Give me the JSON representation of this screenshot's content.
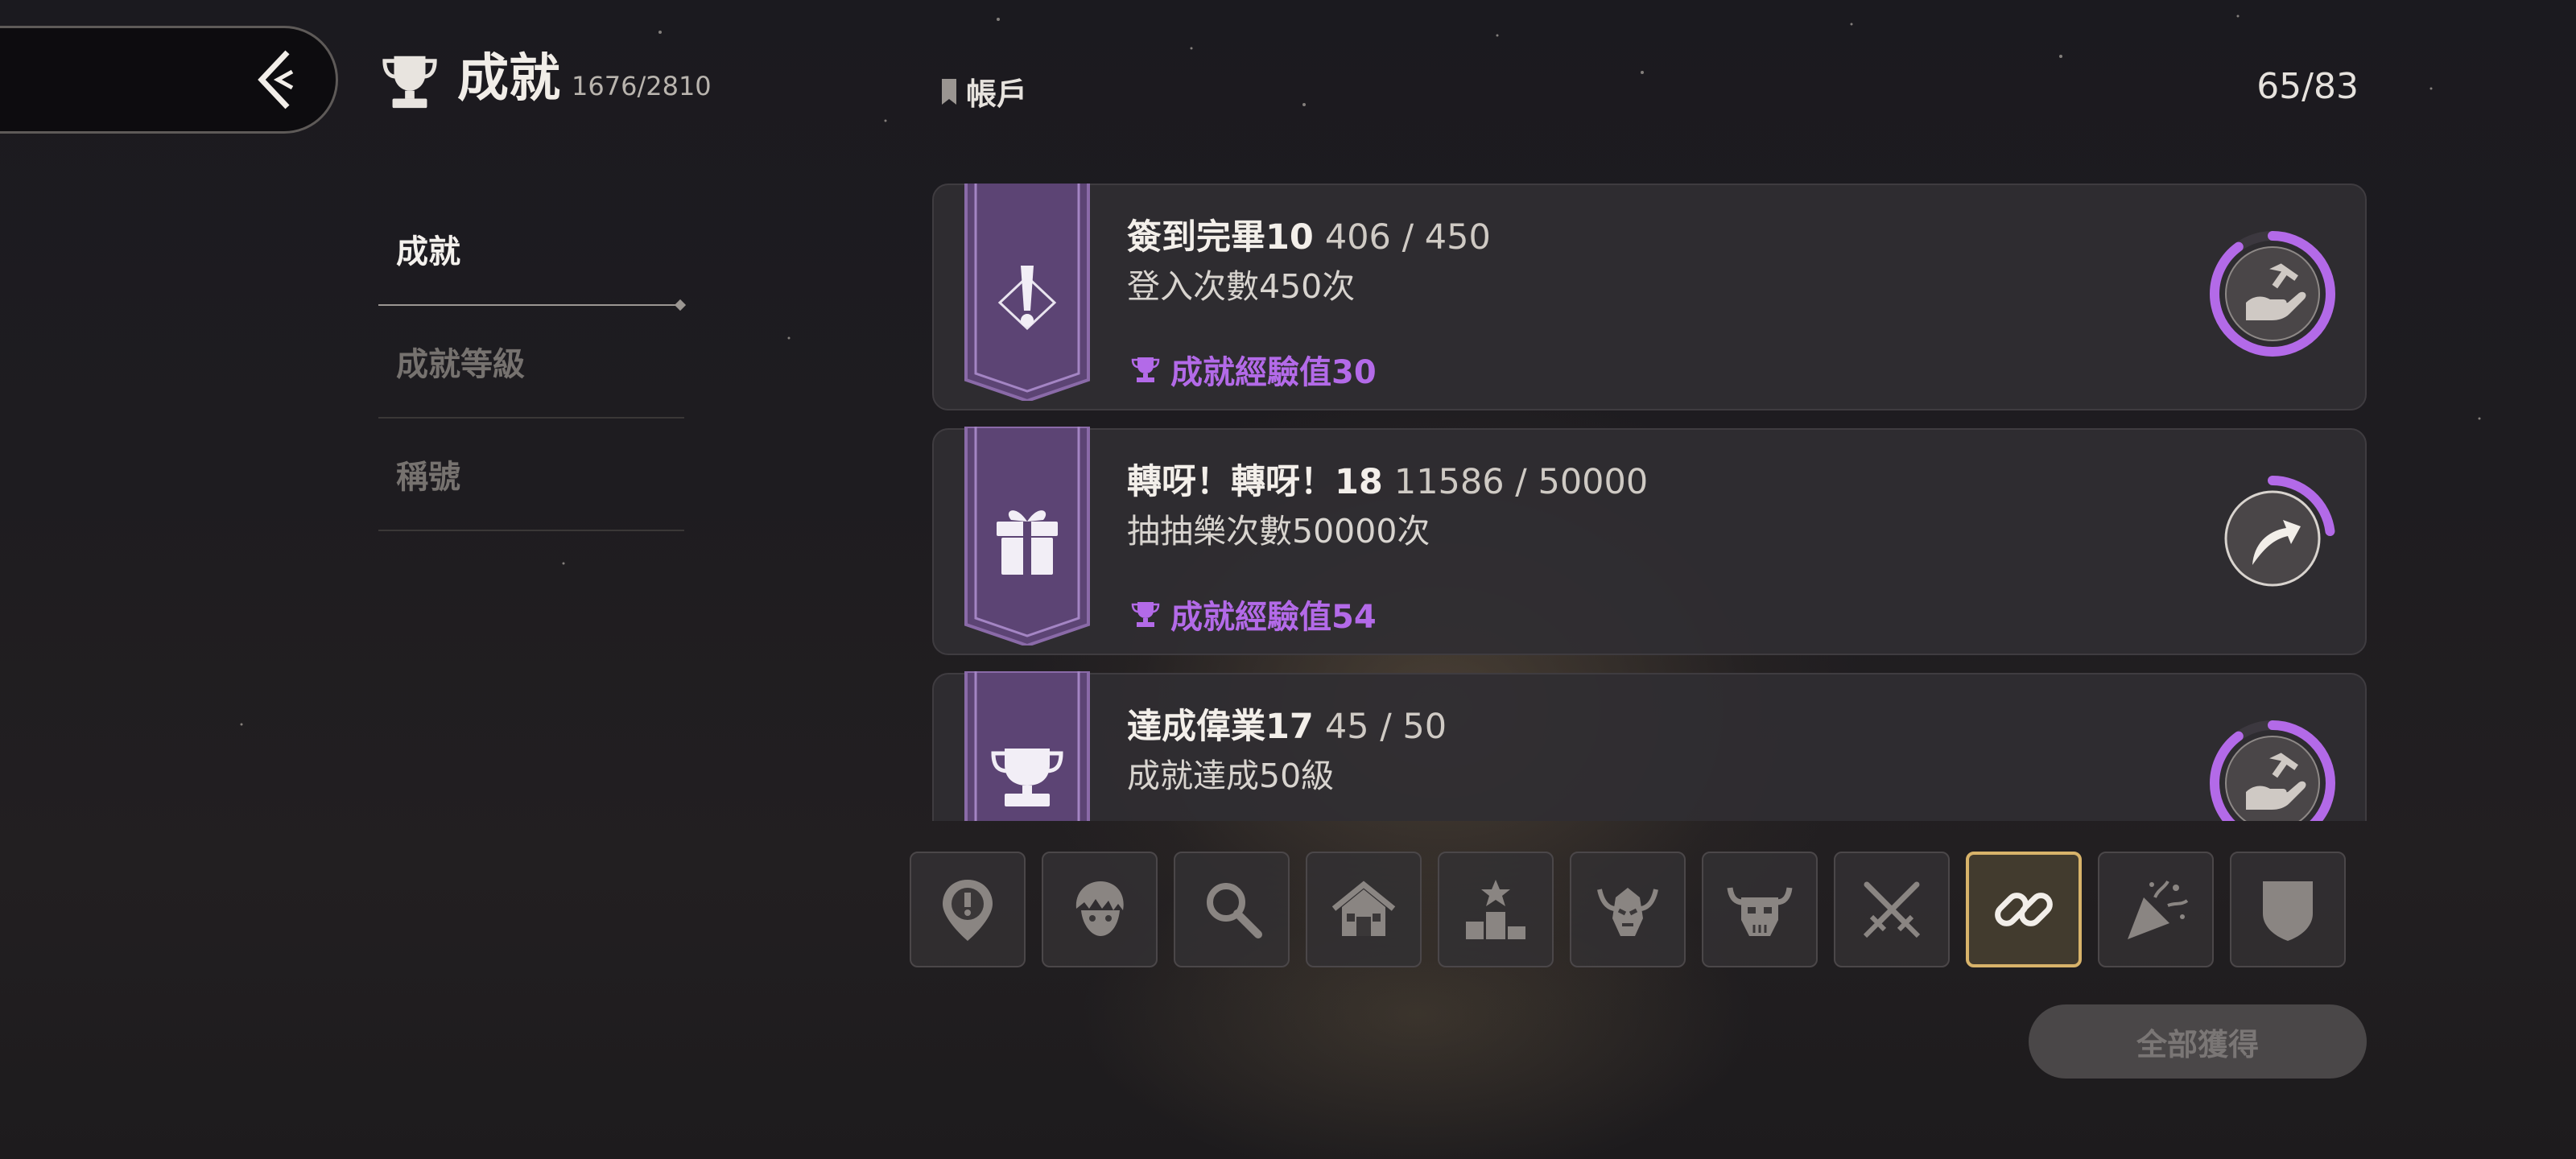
{
  "header": {
    "title": "成就",
    "count": "1676/2810",
    "back_icon": "chevron-left-icon",
    "trophy_icon": "trophy-icon"
  },
  "side_nav": {
    "items": [
      {
        "label": "成就",
        "active": true
      },
      {
        "label": "成就等級",
        "active": false
      },
      {
        "label": "稱號",
        "active": false
      }
    ]
  },
  "category": {
    "label": "帳戶",
    "page_count": "65/83"
  },
  "achievements": [
    {
      "name": "簽到完畢10",
      "progress": "406 / 450",
      "description": "登入次數450次",
      "reward": "成就經驗值30",
      "banner_icon": "exclamation-icon",
      "status_icon": "claim-reward-icon",
      "completion": 0.9
    },
    {
      "name": "轉呀！轉呀！18",
      "progress": "11586 / 50000",
      "description": "抽抽樂次數50000次",
      "reward": "成就經驗值54",
      "banner_icon": "gift-icon",
      "status_icon": "go-shortcut-icon",
      "completion": 0.23
    },
    {
      "name": "達成偉業17",
      "progress": "45 / 50",
      "description": "成就達成50級",
      "reward": "",
      "banner_icon": "trophy-icon",
      "status_icon": "claim-reward-icon",
      "completion": 0.9
    }
  ],
  "tabs": [
    {
      "icon": "map-pin-alert-icon",
      "active": false
    },
    {
      "icon": "character-face-icon",
      "active": false
    },
    {
      "icon": "magnifier-icon",
      "active": false
    },
    {
      "icon": "house-icon",
      "active": false
    },
    {
      "icon": "podium-icon",
      "active": false
    },
    {
      "icon": "demon-icon",
      "active": false
    },
    {
      "icon": "ox-skull-icon",
      "active": false
    },
    {
      "icon": "crossed-swords-icon",
      "active": false
    },
    {
      "icon": "link-icon",
      "active": true
    },
    {
      "icon": "party-popper-icon",
      "active": false
    },
    {
      "icon": "shield-icon",
      "active": false
    }
  ],
  "claim_all_label": "全部獲得",
  "colors": {
    "accent_purple": "#b36ae8",
    "active_tab_border": "#d8b36a",
    "banner_purple": "#6b4d86"
  }
}
